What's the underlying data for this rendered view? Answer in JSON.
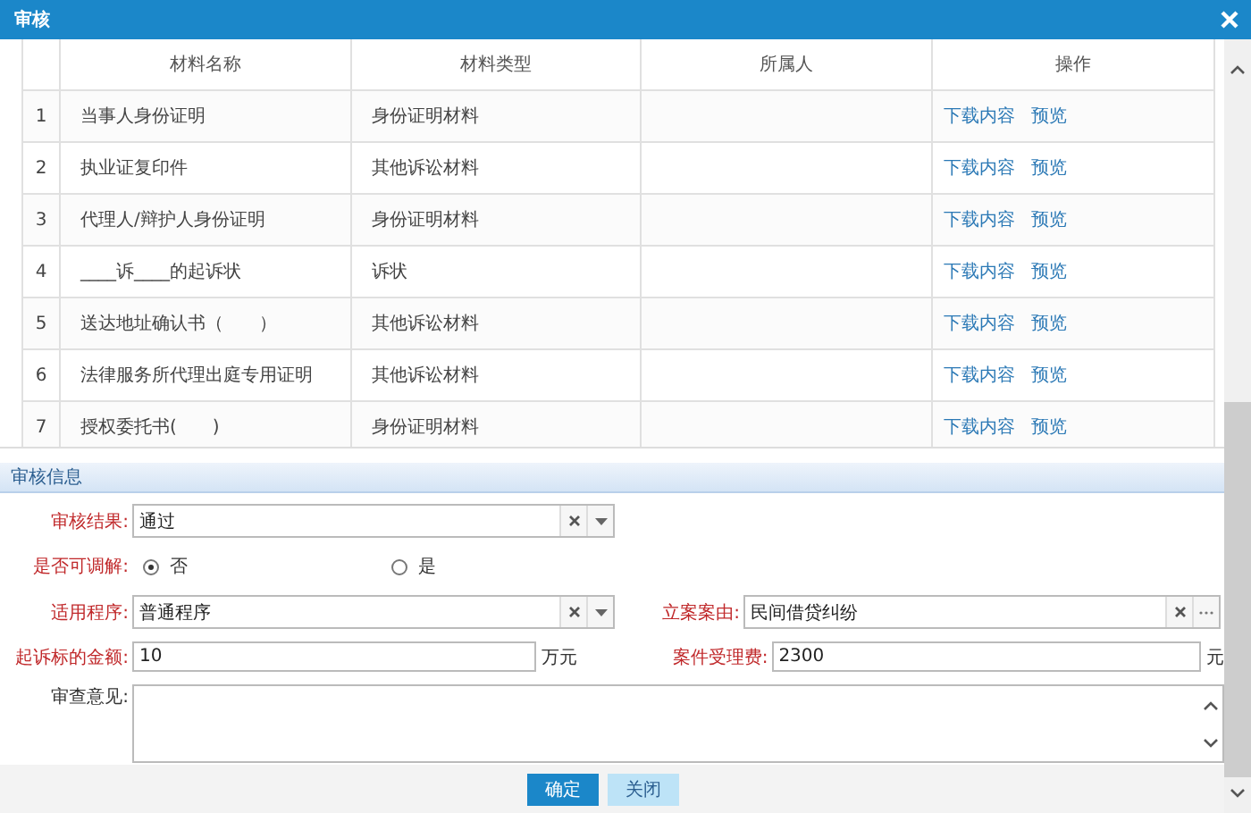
{
  "dialog": {
    "title": "审核"
  },
  "table": {
    "columns": [
      "材料名称",
      "材料类型",
      "所属人",
      "操作"
    ],
    "rows": [
      {
        "index": "1",
        "name": "当事人身份证明",
        "type": "身份证明材料",
        "actions": [
          "下载内容",
          "预览"
        ]
      },
      {
        "index": "2",
        "name": "执业证复印件",
        "type": "其他诉讼材料",
        "actions": [
          "下载内容",
          "预览"
        ]
      },
      {
        "index": "3",
        "name": "代理人/辩护人身份证明",
        "type": "身份证明材料",
        "actions": [
          "下载内容",
          "预览"
        ]
      },
      {
        "index": "4",
        "name": "____诉____的起诉状",
        "type": "诉状",
        "actions": [
          "下载内容",
          "预览"
        ]
      },
      {
        "index": "5",
        "name": "送达地址确认书（　　）",
        "type": "其他诉讼材料",
        "actions": [
          "下载内容",
          "预览"
        ]
      },
      {
        "index": "6",
        "name": "法律服务所代理出庭专用证明",
        "type": "其他诉讼材料",
        "actions": [
          "下载内容",
          "预览"
        ]
      },
      {
        "index": "7",
        "name": "授权委托书(　　)",
        "type": "身份证明材料",
        "actions": [
          "下载内容",
          "预览"
        ]
      }
    ]
  },
  "section_title": "审核信息",
  "form": {
    "review_result": {
      "label": "审核结果:",
      "required": true,
      "value": "通过"
    },
    "mediable": {
      "label": "是否可调解:",
      "required": true,
      "options": [
        {
          "label": "否",
          "selected": true
        },
        {
          "label": "是",
          "selected": false
        }
      ]
    },
    "procedure": {
      "label": "适用程序:",
      "required": true,
      "value": "普通程序"
    },
    "case_cause": {
      "label": "立案案由:",
      "required": true,
      "value": "民间借贷纠纷"
    },
    "amount": {
      "label": "起诉标的金额:",
      "required": true,
      "value": "10",
      "unit": "万元"
    },
    "fee": {
      "label": "案件受理费:",
      "required": true,
      "value": "2300",
      "unit": "元"
    },
    "opinion": {
      "label": "审查意见:",
      "required": false
    }
  },
  "buttons": [
    {
      "label": "确定",
      "kind": "primary"
    },
    {
      "label": "关闭",
      "kind": "secondary"
    }
  ]
}
